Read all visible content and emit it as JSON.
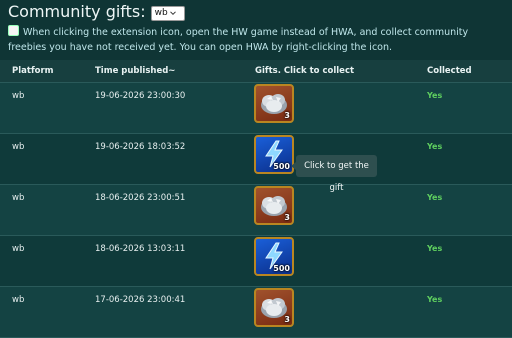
{
  "header": {
    "title": "Community gifts:",
    "platform_select": "wb"
  },
  "note": "When clicking the extension icon, open the HW game instead of HWA, and collect community freebies you have not received yet. You can open HWA by right-clicking the icon.",
  "table": {
    "columns": [
      "Platform",
      "Time published~",
      "Gifts. Click to collect",
      "Collected"
    ],
    "rows": [
      {
        "platform": "wb",
        "time": "19-06-2026 23:00:30",
        "gift": {
          "icon": "silver-coins-icon",
          "qty": "3"
        },
        "collected": "Yes"
      },
      {
        "platform": "wb",
        "time": "19-06-2026 18:03:52",
        "gift": {
          "icon": "energy-lightning-icon",
          "qty": "500"
        },
        "collected": "Yes"
      },
      {
        "platform": "wb",
        "time": "18-06-2026 23:00:51",
        "gift": {
          "icon": "silver-coins-icon",
          "qty": "3"
        },
        "collected": "Yes"
      },
      {
        "platform": "wb",
        "time": "18-06-2026 13:03:11",
        "gift": {
          "icon": "energy-lightning-icon",
          "qty": "500"
        },
        "collected": "Yes"
      },
      {
        "platform": "wb",
        "time": "17-06-2026 23:00:41",
        "gift": {
          "icon": "silver-coins-icon",
          "qty": "3"
        },
        "collected": "Yes"
      }
    ]
  },
  "tooltip": "Click to get the gift",
  "colors": {
    "background": "#0f3535",
    "collected": "#5fcf5f",
    "gift_border": "#b98621"
  }
}
